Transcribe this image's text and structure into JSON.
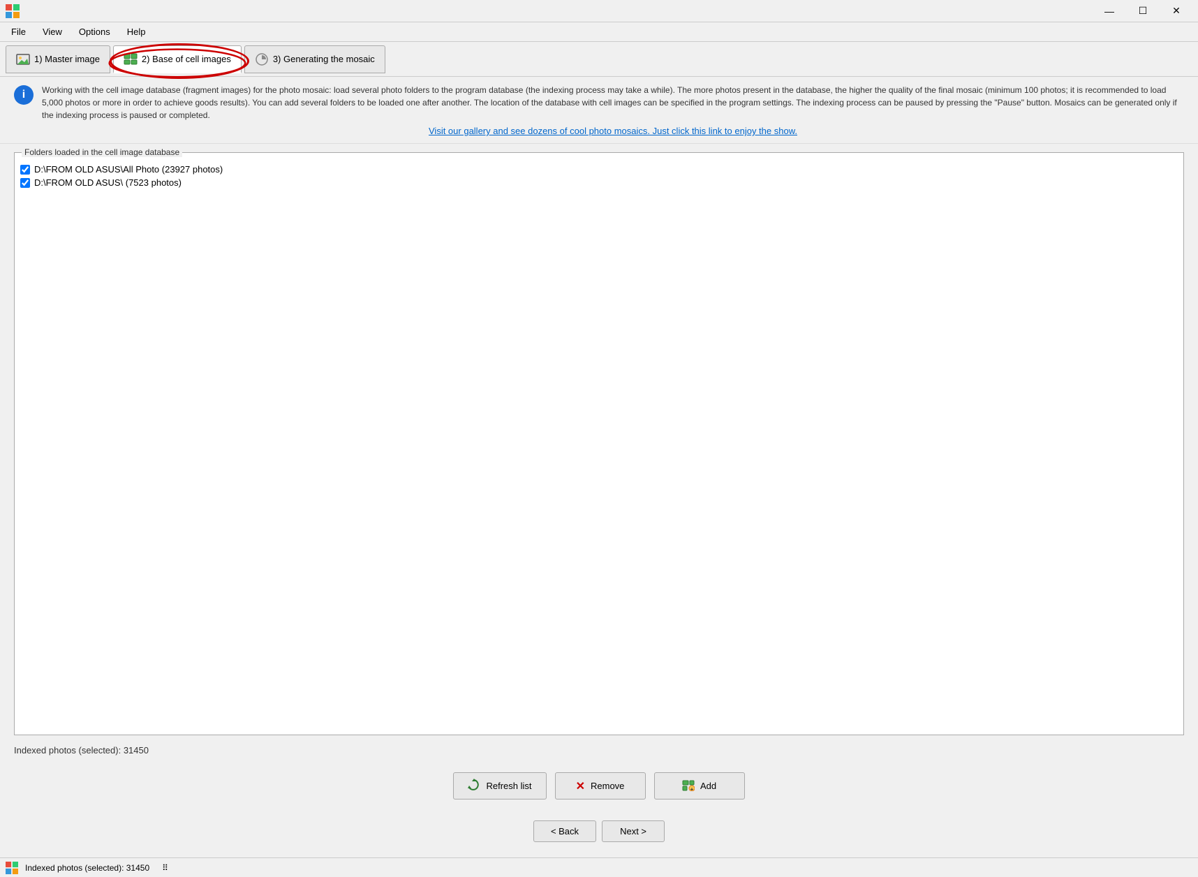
{
  "titleBar": {
    "icon": "mosaic-app-icon",
    "controls": {
      "minimize": "—",
      "maximize": "☐",
      "close": "✕"
    }
  },
  "menuBar": {
    "items": [
      "File",
      "View",
      "Options",
      "Help"
    ]
  },
  "tabs": [
    {
      "id": "tab1",
      "label": "1) Master image",
      "active": false
    },
    {
      "id": "tab2",
      "label": "2) Base of cell images",
      "active": true
    },
    {
      "id": "tab3",
      "label": "3) Generating the mosaic",
      "active": false
    }
  ],
  "infoText": "Working with the cell image database (fragment images) for the photo mosaic: load several photo folders to the program database (the indexing process may take a while). The more photos present in the database, the higher the quality of the final mosaic (minimum 100 photos; it is recommended to load 5,000 photos or more in order to achieve goods results). You can add several folders to be loaded one after another. The location of the database with cell images can be specified in the program settings. The indexing process can be paused by pressing the \"Pause\" button. Mosaics can be generated only if the indexing process is paused or completed.",
  "galleryLink": "Visit our gallery and see dozens of cool photo mosaics. Just click this link to enjoy the show.",
  "folderGroupLabel": "Folders loaded in the cell image database",
  "folders": [
    {
      "checked": true,
      "path": "D:\\FROM OLD ASUS\\All Photo (23927 photos)"
    },
    {
      "checked": true,
      "path": "D:\\FROM OLD ASUS\\ (7523 photos)"
    }
  ],
  "indexedLabel": "Indexed photos (selected): 31450",
  "buttons": {
    "refreshList": "Refresh list",
    "remove": "Remove",
    "add": "Add",
    "back": "< Back",
    "next": "Next >"
  },
  "statusBar": {
    "label": "Indexed photos (selected): 31450"
  }
}
